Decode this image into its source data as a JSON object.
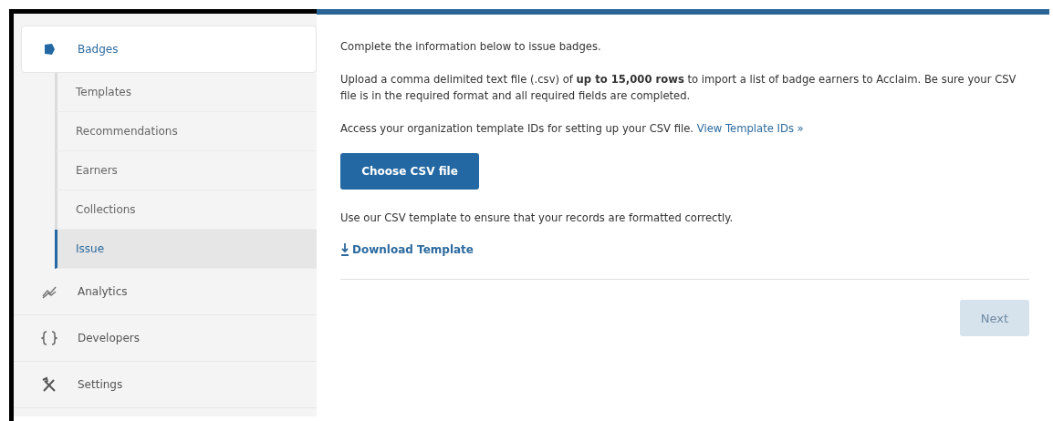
{
  "sidebar": {
    "items": [
      {
        "kind": "badge",
        "label": "Badges",
        "selected": true,
        "children": [
          {
            "label": "Templates",
            "selected": false
          },
          {
            "label": "Recommendations",
            "selected": false
          },
          {
            "label": "Earners",
            "selected": false
          },
          {
            "label": "Collections",
            "selected": false
          },
          {
            "label": "Issue",
            "selected": true
          }
        ]
      },
      {
        "kind": "analytics",
        "label": "Analytics",
        "selected": false
      },
      {
        "kind": "developers",
        "label": "Developers",
        "selected": false
      },
      {
        "kind": "settings",
        "label": "Settings",
        "selected": false
      }
    ]
  },
  "content": {
    "intro": "Complete the information below to issue badges.",
    "upload_text": "Upload a comma delimited text file (.csv) of **up to 15,000 rows** to import a list of badge earners to Acclaim. Be sure your CSV file is in the required format and all required fields are completed.",
    "access_text": "Access your organization template IDs for setting up your CSV file.",
    "access_link": "View Template IDs »",
    "choose_button": "Choose CSV file",
    "template_text": "Use our CSV template to ensure that your records are formatted correctly.",
    "download_link": "Download Template",
    "next_button": {
      "label": "Next",
      "disabled": true
    }
  }
}
